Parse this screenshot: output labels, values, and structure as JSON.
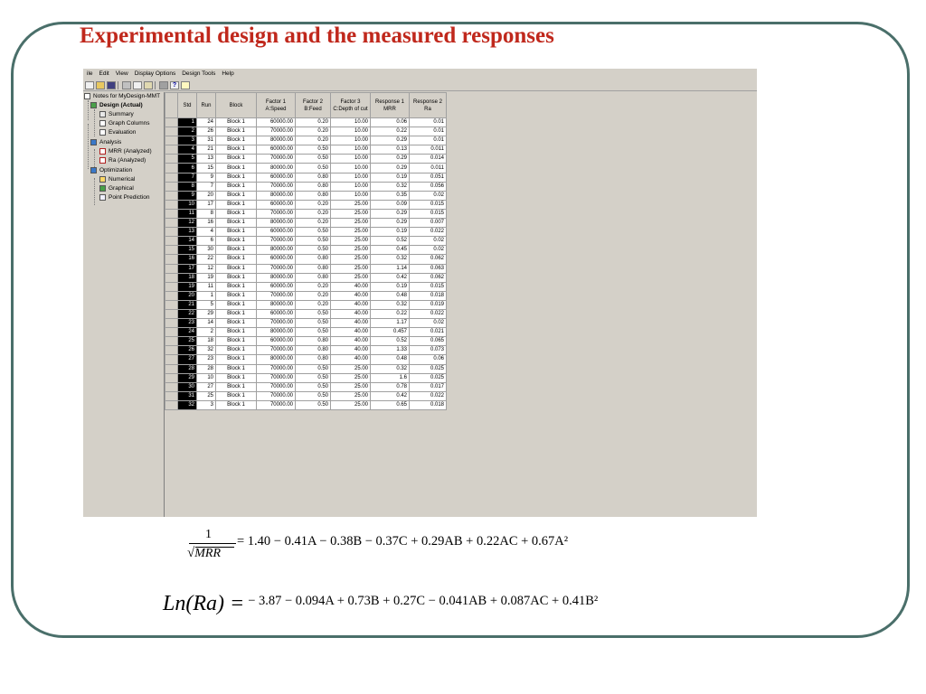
{
  "slide": {
    "title": "Experimental design and the measured responses"
  },
  "app": {
    "menu": [
      "ile",
      "Edit",
      "View",
      "Display Options",
      "Design Tools",
      "Help"
    ],
    "toolbar": {
      "icons": [
        "new-file-icon",
        "open-folder-icon",
        "save-icon",
        "cut-icon",
        "copy-icon",
        "paste-icon",
        "print-icon",
        "help-icon",
        "bulb-icon"
      ],
      "help_glyph": "?"
    },
    "tree": {
      "root": "Notes for MyDesign-MMT",
      "design": "Design (Actual)",
      "summary": "Summary",
      "graph_columns": "Graph Columns",
      "evaluation": "Evaluation",
      "analysis": "Analysis",
      "mrr": "MRR (Analyzed)",
      "ra": "Ra (Analyzed)",
      "optimization": "Optimization",
      "numerical": "Numerical",
      "graphical": "Graphical",
      "point_prediction": "Point Prediction"
    },
    "grid": {
      "headers": {
        "std": "Std",
        "run": "Run",
        "block": "Block",
        "f1_line1": "Factor 1",
        "f1_line2": "A:Speed",
        "f2_line1": "Factor 2",
        "f2_line2": "B:Feed",
        "f3_line1": "Factor 3",
        "f3_line2": "C:Depth of cut",
        "r1_line1": "Response 1",
        "r1_line2": "MRR",
        "r2_line1": "Response 2",
        "r2_line2": "Ra"
      },
      "rows": [
        [
          "1",
          "24",
          "Block 1",
          "60000.00",
          "0.20",
          "10.00",
          "0.06",
          "0.01"
        ],
        [
          "2",
          "26",
          "Block 1",
          "70000.00",
          "0.20",
          "10.00",
          "0.22",
          "0.01"
        ],
        [
          "3",
          "31",
          "Block 1",
          "80000.00",
          "0.20",
          "10.00",
          "0.29",
          "0.01"
        ],
        [
          "4",
          "21",
          "Block 1",
          "60000.00",
          "0.50",
          "10.00",
          "0.13",
          "0.011"
        ],
        [
          "5",
          "13",
          "Block 1",
          "70000.00",
          "0.50",
          "10.00",
          "0.29",
          "0.014"
        ],
        [
          "6",
          "15",
          "Block 1",
          "80000.00",
          "0.50",
          "10.00",
          "0.29",
          "0.011"
        ],
        [
          "7",
          "9",
          "Block 1",
          "60000.00",
          "0.80",
          "10.00",
          "0.19",
          "0.051"
        ],
        [
          "8",
          "7",
          "Block 1",
          "70000.00",
          "0.80",
          "10.00",
          "0.32",
          "0.056"
        ],
        [
          "9",
          "20",
          "Block 1",
          "80000.00",
          "0.80",
          "10.00",
          "0.35",
          "0.02"
        ],
        [
          "10",
          "17",
          "Block 1",
          "60000.00",
          "0.20",
          "25.00",
          "0.09",
          "0.015"
        ],
        [
          "11",
          "8",
          "Block 1",
          "70000.00",
          "0.20",
          "25.00",
          "0.29",
          "0.015"
        ],
        [
          "12",
          "16",
          "Block 1",
          "80000.00",
          "0.20",
          "25.00",
          "0.29",
          "0.007"
        ],
        [
          "13",
          "4",
          "Block 1",
          "60000.00",
          "0.50",
          "25.00",
          "0.19",
          "0.022"
        ],
        [
          "14",
          "6",
          "Block 1",
          "70000.00",
          "0.50",
          "25.00",
          "0.52",
          "0.02"
        ],
        [
          "15",
          "30",
          "Block 1",
          "80000.00",
          "0.50",
          "25.00",
          "0.45",
          "0.02"
        ],
        [
          "16",
          "22",
          "Block 1",
          "60000.00",
          "0.80",
          "25.00",
          "0.32",
          "0.062"
        ],
        [
          "17",
          "12",
          "Block 1",
          "70000.00",
          "0.80",
          "25.00",
          "1.14",
          "0.063"
        ],
        [
          "18",
          "19",
          "Block 1",
          "80000.00",
          "0.80",
          "25.00",
          "0.42",
          "0.062"
        ],
        [
          "19",
          "11",
          "Block 1",
          "60000.00",
          "0.20",
          "40.00",
          "0.19",
          "0.015"
        ],
        [
          "20",
          "1",
          "Block 1",
          "70000.00",
          "0.20",
          "40.00",
          "0.48",
          "0.018"
        ],
        [
          "21",
          "5",
          "Block 1",
          "80000.00",
          "0.20",
          "40.00",
          "0.32",
          "0.019"
        ],
        [
          "22",
          "29",
          "Block 1",
          "60000.00",
          "0.50",
          "40.00",
          "0.22",
          "0.022"
        ],
        [
          "23",
          "14",
          "Block 1",
          "70000.00",
          "0.50",
          "40.00",
          "1.17",
          "0.02"
        ],
        [
          "24",
          "2",
          "Block 1",
          "80000.00",
          "0.50",
          "40.00",
          "0.457",
          "0.021"
        ],
        [
          "25",
          "18",
          "Block 1",
          "60000.00",
          "0.80",
          "40.00",
          "0.52",
          "0.065"
        ],
        [
          "26",
          "32",
          "Block 1",
          "70000.00",
          "0.80",
          "40.00",
          "1.33",
          "0.073"
        ],
        [
          "27",
          "23",
          "Block 1",
          "80000.00",
          "0.80",
          "40.00",
          "0.48",
          "0.06"
        ],
        [
          "28",
          "28",
          "Block 1",
          "70000.00",
          "0.50",
          "25.00",
          "0.32",
          "0.025"
        ],
        [
          "29",
          "10",
          "Block 1",
          "70000.00",
          "0.50",
          "25.00",
          "1.6",
          "0.025"
        ],
        [
          "30",
          "27",
          "Block 1",
          "70000.00",
          "0.50",
          "25.00",
          "0.78",
          "0.017"
        ],
        [
          "31",
          "25",
          "Block 1",
          "70000.00",
          "0.50",
          "25.00",
          "0.42",
          "0.022"
        ],
        [
          "32",
          "3",
          "Block 1",
          "70000.00",
          "0.50",
          "25.00",
          "0.65",
          "0.018"
        ]
      ]
    }
  },
  "equations": {
    "eq1": {
      "numerator": "1",
      "radical": "√",
      "denominator": "MRR",
      "rhs": "= 1.40 − 0.41A − 0.38B − 0.37C + 0.29AB + 0.22AC + 0.67A²"
    },
    "eq2": {
      "lhs": "Ln(Ra) =",
      "rhs": "− 3.87 − 0.094A + 0.73B + 0.27C − 0.041AB + 0.087AC + 0.41B²"
    }
  },
  "colors": {
    "title": "#c0281c",
    "frame": "#4a6f6a",
    "app_background": "#d4d0c8"
  }
}
